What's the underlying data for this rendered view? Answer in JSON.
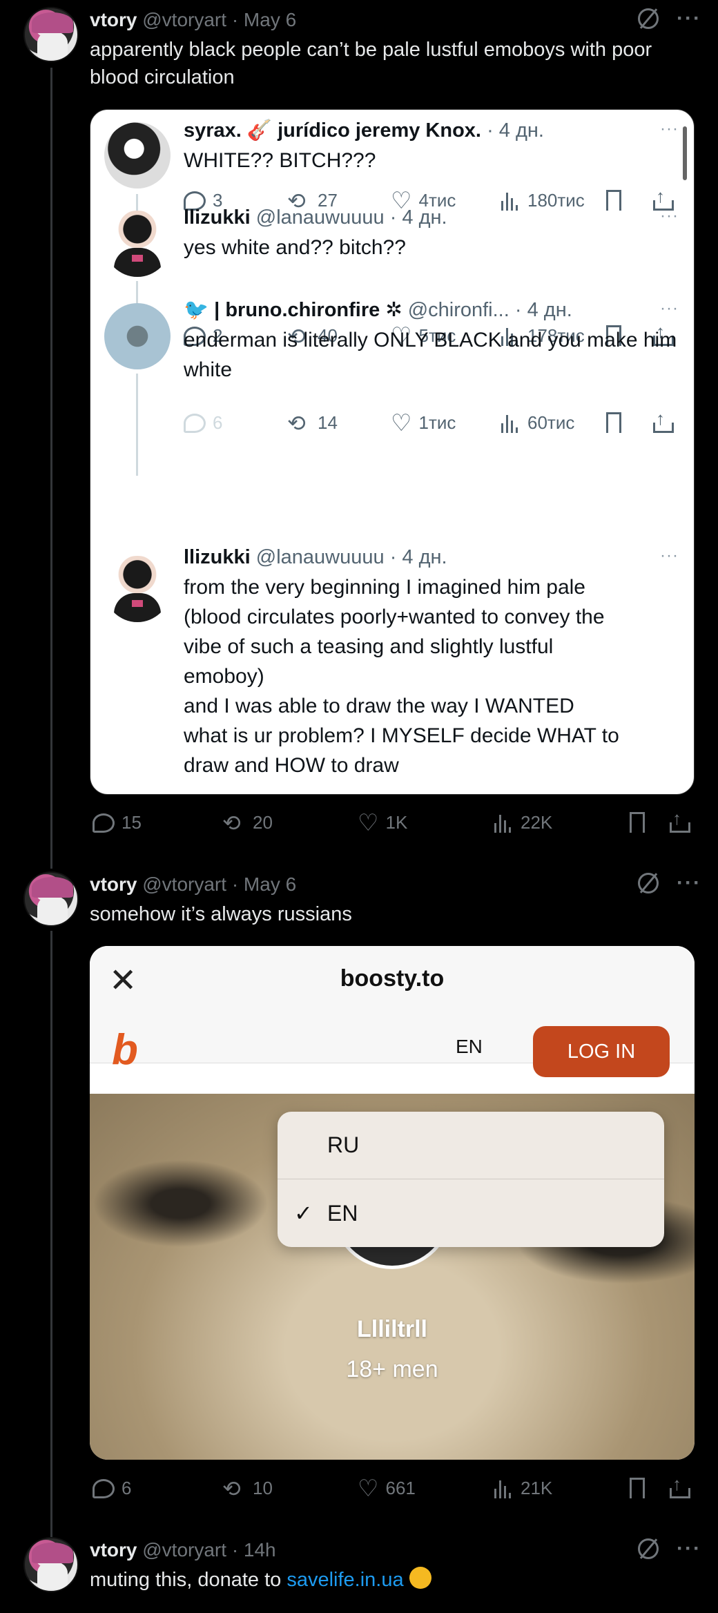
{
  "post1": {
    "name": "vtory",
    "handle": "@vtoryart",
    "date": "· May 6",
    "text": "apparently black people can’t be pale lustful emoboys with poor blood circulation",
    "quotes": [
      {
        "name": "syrax. 🎸 jurídico jeremy Knox.",
        "meta": "· 4 дн.",
        "text": "WHITE?? BITCH???",
        "replies": "3",
        "reposts": "27",
        "likes": "4тис",
        "views": "180тис"
      },
      {
        "name": "llizukki",
        "handle": "@lanauwuuuu",
        "meta": "· 4 дн.",
        "text": "yes white and?? bitch??",
        "replies": "2",
        "reposts": "40",
        "likes": "5тис",
        "views": "178тис"
      },
      {
        "name": "🐦 | bruno.chironfire ✲",
        "handle": "@chironfi...",
        "meta": "· 4 дн.",
        "text": "enderman is literally ONLY BLACK and you make him white",
        "replies": "6",
        "reposts": "14",
        "likes": "1тис",
        "views": "60тис"
      },
      {
        "name": "llizukki",
        "handle": "@lanauwuuuu",
        "meta": "· 4 дн.",
        "text_lines": [
          "from the very beginning I imagined him pale",
          "(blood circulates poorly+wanted to convey the",
          "vibe of such a teasing and slightly lustful",
          "emoboy)",
          "and I was able to draw the way I WANTED",
          "what is ur problem? I MYSELF decide WHAT to",
          "draw and HOW to draw"
        ]
      }
    ],
    "stats": {
      "replies": "15",
      "reposts": "20",
      "likes": "1K",
      "views": "22K"
    }
  },
  "post2": {
    "name": "vtory",
    "handle": "@vtoryart",
    "date": "· May 6",
    "text": "somehow it’s always russians",
    "boosty": {
      "domain": "boosty.to",
      "lang": "EN",
      "login": "LOG IN",
      "options": [
        "RU",
        "EN"
      ],
      "check": "✓",
      "username": "Llliltrll",
      "subtitle": "18+ men"
    },
    "stats": {
      "replies": "6",
      "reposts": "10",
      "likes": "661",
      "views": "21K"
    }
  },
  "post3": {
    "name": "vtory",
    "handle": "@vtoryart",
    "date": "· 14h",
    "text_prefix": "muting this, donate to ",
    "link": "savelife.in.ua"
  },
  "icons": {
    "dots": "···",
    "close": "✕",
    "logo": "b",
    "retweet": "⟲",
    "heart": "♡"
  }
}
